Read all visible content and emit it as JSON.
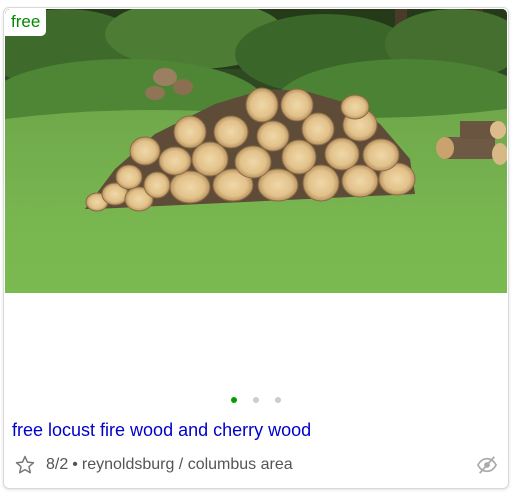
{
  "listing": {
    "price": "free",
    "title": "free locust fire wood and cherry wood",
    "date": "8/2",
    "separator": "•",
    "location": "reynoldsburg / columbus area",
    "image_count": 3,
    "active_image_index": 0
  },
  "icons": {
    "favorite": "star-outline-icon",
    "hide": "eye-slash-icon"
  },
  "colors": {
    "price": "#008a00",
    "title_link": "#0000cc",
    "active_dot": "#00a000",
    "inactive_dot": "#cccccc"
  }
}
